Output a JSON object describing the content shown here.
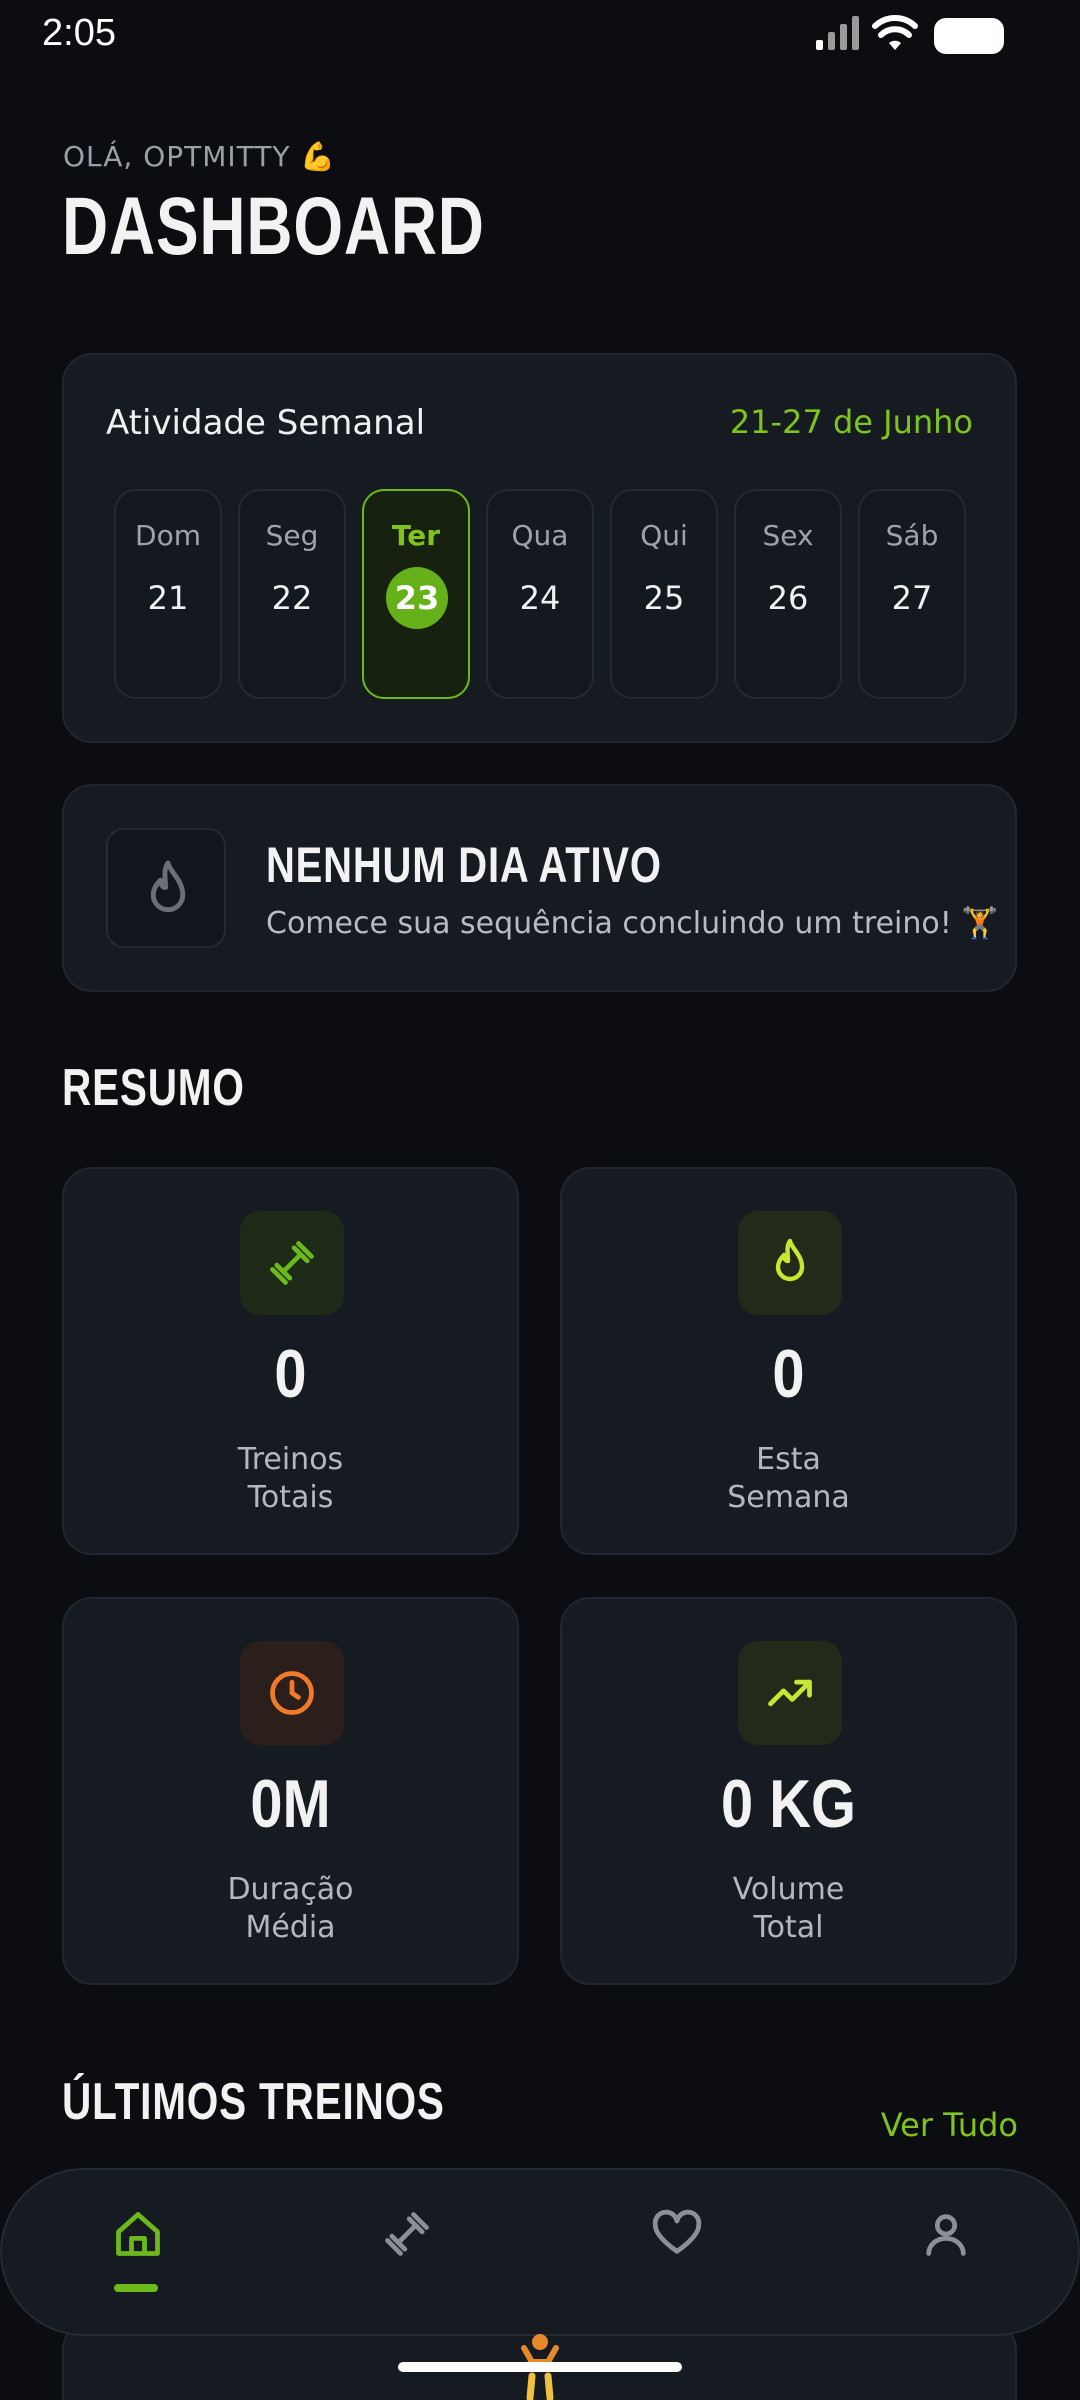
{
  "status_bar": {
    "time": "2:05"
  },
  "header": {
    "greeting": "OLÁ, OPTMITTY 💪",
    "title": "DASHBOARD"
  },
  "weekly": {
    "title": "Atividade Semanal",
    "range": "21-27 de Junho",
    "days": [
      {
        "name": "Dom",
        "date": "21"
      },
      {
        "name": "Seg",
        "date": "22"
      },
      {
        "name": "Ter",
        "date": "23",
        "active": true
      },
      {
        "name": "Qua",
        "date": "24"
      },
      {
        "name": "Qui",
        "date": "25"
      },
      {
        "name": "Sex",
        "date": "26"
      },
      {
        "name": "Sáb",
        "date": "27"
      }
    ]
  },
  "streak": {
    "title": "NENHUM DIA ATIVO",
    "subtitle": "Comece sua sequência concluindo um treino! 🏋️"
  },
  "summary": {
    "title": "RESUMO",
    "stats": [
      {
        "icon": "dumbbell-icon",
        "value": "0",
        "label_line1": "Treinos",
        "label_line2": "Totais"
      },
      {
        "icon": "flame-icon",
        "value": "0",
        "label_line1": "Esta",
        "label_line2": "Semana"
      },
      {
        "icon": "clock-icon",
        "value": "0M",
        "label_line1": "Duração",
        "label_line2": "Média"
      },
      {
        "icon": "trending-up-icon",
        "value": "0 KG",
        "label_line1": "Volume",
        "label_line2": "Total"
      }
    ]
  },
  "recent": {
    "title": "ÚLTIMOS TREINOS",
    "see_all": "Ver Tudo"
  },
  "colors": {
    "accent": "#6db91b",
    "orange": "#f07a2a",
    "lime": "#c8e632",
    "background": "#0b0d10",
    "card": "#161b22"
  },
  "nav": {
    "items": [
      "home-icon",
      "dumbbell-icon",
      "heart-icon",
      "user-icon"
    ],
    "active": "home-icon"
  }
}
